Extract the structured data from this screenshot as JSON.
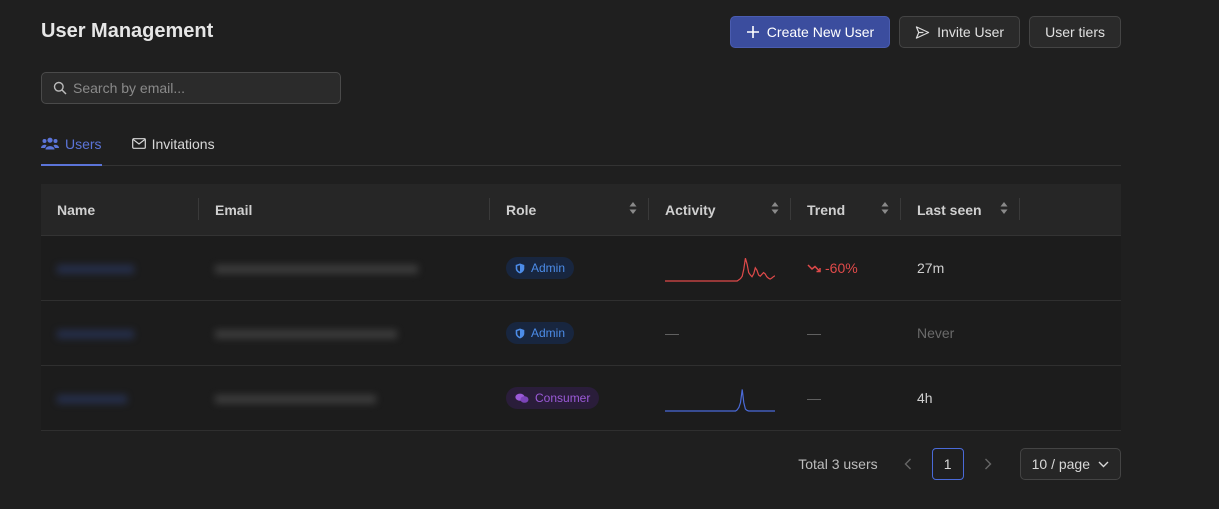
{
  "header": {
    "title": "User Management",
    "create_label": "Create New User",
    "invite_label": "Invite User",
    "tiers_label": "User tiers"
  },
  "search": {
    "placeholder": "Search by email..."
  },
  "tabs": [
    {
      "label": "Users",
      "active": true,
      "icon": "users-icon"
    },
    {
      "label": "Invitations",
      "active": false,
      "icon": "mail-icon"
    }
  ],
  "table": {
    "columns": [
      "Name",
      "Email",
      "Role",
      "Activity",
      "Trend",
      "Last seen"
    ],
    "rows": [
      {
        "name": "xxxxxxxxxxx",
        "email": "xxxxxxxxxxxxxxxxxxxxxxxxxxxxx",
        "role": "Admin",
        "activity": [
          0,
          0,
          0,
          0,
          0,
          0,
          0,
          0,
          0,
          0,
          0,
          0,
          0,
          0,
          0,
          0,
          0,
          0,
          0,
          0,
          0,
          0,
          0,
          0,
          0,
          0,
          0,
          0,
          0,
          0,
          0,
          0,
          0,
          0,
          0,
          0,
          0,
          0,
          0,
          0,
          0,
          0,
          0,
          0,
          0,
          0.05,
          0.1,
          0.2,
          0.5,
          0.95,
          0.7,
          0.35,
          0.25,
          0.18,
          0.3,
          0.55,
          0.45,
          0.25,
          0.2,
          0.28,
          0.35,
          0.3,
          0.18,
          0.12,
          0.08,
          0.12,
          0.18,
          0.22
        ],
        "activity_color": "#e04a4a",
        "trend": "-60%",
        "last_seen": "27m"
      },
      {
        "name": "xxxxxxxxxxx",
        "email": "xxxxxxxxxxxxxxxxxxxxxxxxxx",
        "role": "Admin",
        "activity": null,
        "trend": "—",
        "activity_dash": "—",
        "last_seen": "Never"
      },
      {
        "name": "xxxxxxxxxx",
        "email": "xxxxxxxxxxxxxxxxxxxxxxx",
        "role": "Consumer",
        "activity": [
          0,
          0,
          0,
          0,
          0,
          0,
          0,
          0,
          0,
          0,
          0,
          0,
          0,
          0,
          0,
          0,
          0,
          0,
          0,
          0,
          0,
          0,
          0,
          0,
          0,
          0,
          0,
          0,
          0,
          0,
          0,
          0,
          0,
          0,
          0,
          0,
          0,
          0,
          0,
          0,
          0,
          0,
          0,
          0,
          0.05,
          0.15,
          0.35,
          0.9,
          0.35,
          0.08,
          0.02,
          0,
          0,
          0,
          0,
          0,
          0,
          0,
          0,
          0,
          0,
          0,
          0,
          0,
          0,
          0,
          0,
          0
        ],
        "activity_color": "#4a6ad8",
        "trend": "—",
        "last_seen": "4h"
      }
    ]
  },
  "pagination": {
    "total": "Total 3 users",
    "page": "1",
    "page_size": "10 / page"
  },
  "colors": {
    "primary": "#3b4d9e",
    "accent": "#5b74d8",
    "admin": "#4c8ce8",
    "consumer": "#9b5ad8",
    "negative": "#e04a4a"
  }
}
